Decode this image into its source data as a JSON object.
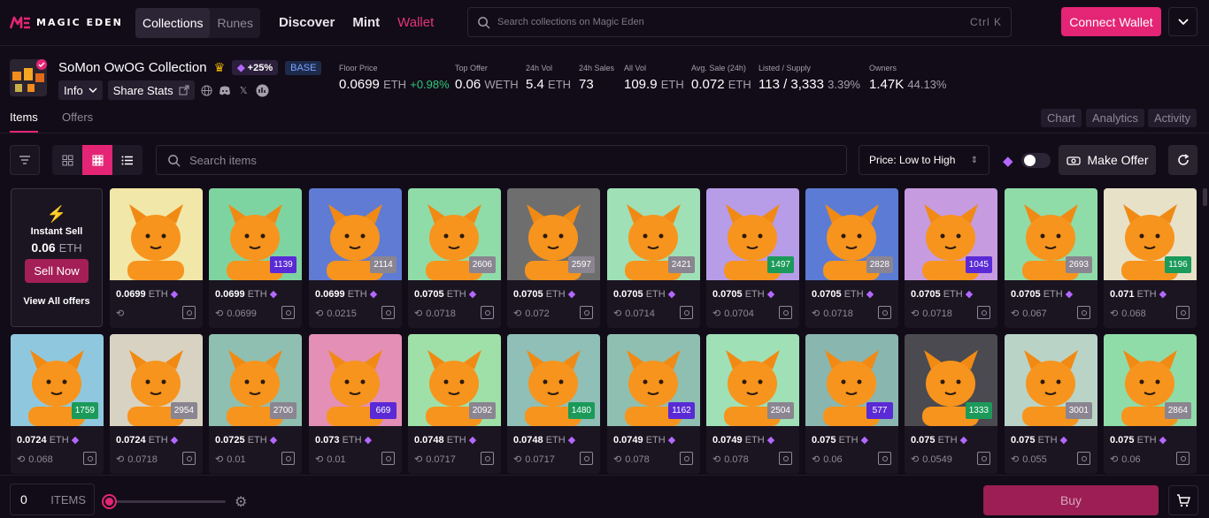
{
  "brand": {
    "name": "MAGIC EDEN",
    "accent": "#e42575"
  },
  "segment": {
    "collections": "Collections",
    "runes": "Runes"
  },
  "nav": {
    "discover": "Discover",
    "mint": "Mint",
    "wallet": "Wallet"
  },
  "search": {
    "placeholder": "Search collections on Magic Eden",
    "shortcut": "Ctrl K"
  },
  "connect_label": "Connect Wallet",
  "collection": {
    "name": "SoMon OwOG Collection",
    "boost": "+25%",
    "chain": "BASE",
    "info_label": "Info",
    "share_label": "Share Stats"
  },
  "stats": [
    {
      "label": "Floor Price",
      "value": "0.0699",
      "unit": "ETH",
      "change": "+0.98%"
    },
    {
      "label": "Top Offer",
      "value": "0.06",
      "unit": "WETH"
    },
    {
      "label": "24h Vol",
      "value": "5.4",
      "unit": "ETH"
    },
    {
      "label": "24h Sales",
      "value": "73",
      "unit": ""
    },
    {
      "label": "All Vol",
      "value": "109.9",
      "unit": "ETH"
    },
    {
      "label": "Avg. Sale (24h)",
      "value": "0.072",
      "unit": "ETH"
    },
    {
      "label": "Listed / Supply",
      "value": "113 / 3,333",
      "unit": "3.39%"
    },
    {
      "label": "Owners",
      "value": "1.47K",
      "unit": "44.13%"
    }
  ],
  "tabs": {
    "items": "Items",
    "offers": "Offers",
    "chart": "Chart",
    "analytics": "Analytics",
    "activity": "Activity"
  },
  "toolbar": {
    "search_placeholder": "Search items",
    "sort": "Price: Low to High",
    "make_offer": "Make Offer"
  },
  "instant_sell": {
    "title": "Instant Sell",
    "value": "0.06",
    "unit": "ETH",
    "sell_label": "Sell Now",
    "view_all": "View All offers"
  },
  "nfts": [
    {
      "price": "0.0699",
      "last": "",
      "rank": "",
      "bg": "#f1e7a8",
      "rank_color": ""
    },
    {
      "price": "0.0699",
      "last": "0.0699",
      "rank": "1139",
      "bg": "#7ed4a1",
      "rank_color": "#5a2ad6"
    },
    {
      "price": "0.0699",
      "last": "0.0215",
      "rank": "2114",
      "bg": "#5f7bd4",
      "rank_color": "#8a8590"
    },
    {
      "price": "0.0705",
      "last": "0.0718",
      "rank": "2606",
      "bg": "#8fdca8",
      "rank_color": "#8a8590"
    },
    {
      "price": "0.0705",
      "last": "0.072",
      "rank": "2597",
      "bg": "#6e6e6e",
      "rank_color": "#8a8590"
    },
    {
      "price": "0.0705",
      "last": "0.0714",
      "rank": "2421",
      "bg": "#9fe0b6",
      "rank_color": "#8a8590"
    },
    {
      "price": "0.0705",
      "last": "0.0704",
      "rank": "1497",
      "bg": "#b79ce8",
      "rank_color": "#1b9a5a"
    },
    {
      "price": "0.0705",
      "last": "0.0718",
      "rank": "2828",
      "bg": "#5b7bd4",
      "rank_color": "#8a8590"
    },
    {
      "price": "0.0705",
      "last": "0.0718",
      "rank": "1045",
      "bg": "#c79be0",
      "rank_color": "#5a2ad6"
    },
    {
      "price": "0.0705",
      "last": "0.067",
      "rank": "2693",
      "bg": "#8fdca8",
      "rank_color": "#8a8590"
    },
    {
      "price": "0.071",
      "last": "0.068",
      "rank": "1196",
      "bg": "#e7e1c8",
      "rank_color": "#1b9a5a"
    },
    {
      "price": "0.0724",
      "last": "0.068",
      "rank": "1759",
      "bg": "#8fc8de",
      "rank_color": "#1b9a5a"
    },
    {
      "price": "0.0724",
      "last": "0.0718",
      "rank": "2954",
      "bg": "#d8d2c2",
      "rank_color": "#8a8590"
    },
    {
      "price": "0.0725",
      "last": "0.01",
      "rank": "2700",
      "bg": "#8fbfb0",
      "rank_color": "#8a8590"
    },
    {
      "price": "0.073",
      "last": "0.01",
      "rank": "669",
      "bg": "#e48fb5",
      "rank_color": "#5a2ad6"
    },
    {
      "price": "0.0748",
      "last": "0.0717",
      "rank": "2092",
      "bg": "#9fe0a8",
      "rank_color": "#8a8590"
    },
    {
      "price": "0.0748",
      "last": "0.0717",
      "rank": "1480",
      "bg": "#8fbfb6",
      "rank_color": "#1b9a5a"
    },
    {
      "price": "0.0749",
      "last": "0.078",
      "rank": "1162",
      "bg": "#8fbfb0",
      "rank_color": "#5a2ad6"
    },
    {
      "price": "0.0749",
      "last": "0.078",
      "rank": "2504",
      "bg": "#9fe0b6",
      "rank_color": "#8a8590"
    },
    {
      "price": "0.075",
      "last": "0.06",
      "rank": "577",
      "bg": "#8ab6b0",
      "rank_color": "#5a2ad6"
    },
    {
      "price": "0.075",
      "last": "0.0549",
      "rank": "1333",
      "bg": "#4a4a50",
      "rank_color": "#1b9a5a"
    },
    {
      "price": "0.075",
      "last": "0.055",
      "rank": "3001",
      "bg": "#b9d4c6",
      "rank_color": "#8a8590"
    },
    {
      "price": "0.075",
      "last": "0.06",
      "rank": "2864",
      "bg": "#8fdca8",
      "rank_color": "#8a8590"
    }
  ],
  "currency": "ETH",
  "footer": {
    "qty": "0",
    "qty_label": "ITEMS",
    "buy_label": "Buy"
  }
}
